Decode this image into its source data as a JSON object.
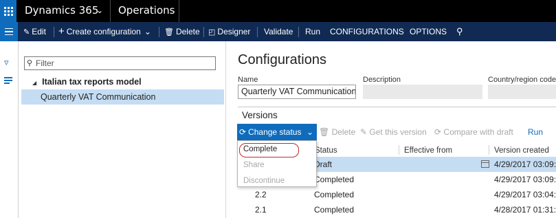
{
  "topbar": {
    "app_name": "Dynamics 365",
    "module_name": "Operations"
  },
  "actions": {
    "edit": "Edit",
    "create_configuration": "Create configuration",
    "delete": "Delete",
    "designer": "Designer",
    "validate": "Validate",
    "run": "Run",
    "configurations": "CONFIGURATIONS",
    "options": "OPTIONS"
  },
  "tree": {
    "filter_placeholder": "Filter",
    "root": "Italian tax reports model",
    "child": "Quarterly VAT Communication"
  },
  "page": {
    "title": "Configurations"
  },
  "fields": {
    "name_label": "Name",
    "name_value": "Quarterly VAT Communication",
    "description_label": "Description",
    "description_value": "",
    "country_label": "Country/region codes",
    "country_value": ""
  },
  "versions": {
    "title": "Versions",
    "change_status": "Change status",
    "delete": "Delete",
    "get_version": "Get this version",
    "compare": "Compare with draft",
    "run": "Run"
  },
  "dropdown": {
    "items": [
      "Complete",
      "Share",
      "Discontinue"
    ]
  },
  "grid": {
    "headers": [
      "Status",
      "Effective from",
      "Version created"
    ],
    "rows": [
      {
        "version": "",
        "status": "Draft",
        "effective_from": "",
        "created": "4/29/2017 03:09:"
      },
      {
        "version": "",
        "status": "Completed",
        "effective_from": "",
        "created": "4/29/2017 03:09:"
      },
      {
        "version": "2.2",
        "status": "Completed",
        "effective_from": "",
        "created": "4/29/2017 03:04:"
      },
      {
        "version": "2.1",
        "status": "Completed",
        "effective_from": "",
        "created": "4/28/2017 01:31:"
      }
    ]
  },
  "colors": {
    "brand_blue": "#0f6cbd",
    "action_pane": "#102a54",
    "selection": "#c5ddf3",
    "annotation_red": "#c62828"
  }
}
